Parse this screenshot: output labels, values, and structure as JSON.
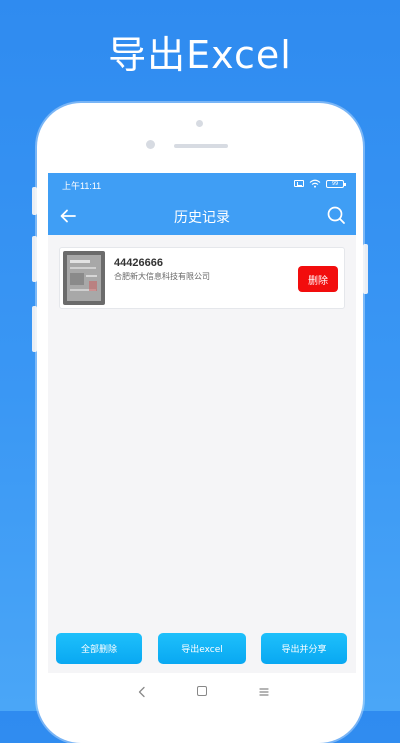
{
  "banner": {
    "title": "导出Excel"
  },
  "status_bar": {
    "time": "上午11:11",
    "battery": "99"
  },
  "header": {
    "title": "历史记录",
    "back_icon": "arrow-left-icon",
    "search_icon": "search-icon"
  },
  "records": [
    {
      "number": "44426666",
      "company": "合肥新大信息科技有限公司",
      "delete_label": "删除"
    }
  ],
  "actions": {
    "delete_all": "全部删除",
    "export_excel": "导出excel",
    "export_share": "导出并分享"
  },
  "colors": {
    "background": "#3a97f4",
    "app_bar": "#3f9ef5",
    "delete_button": "#f20d0d",
    "action_button": "#09a8f2"
  }
}
